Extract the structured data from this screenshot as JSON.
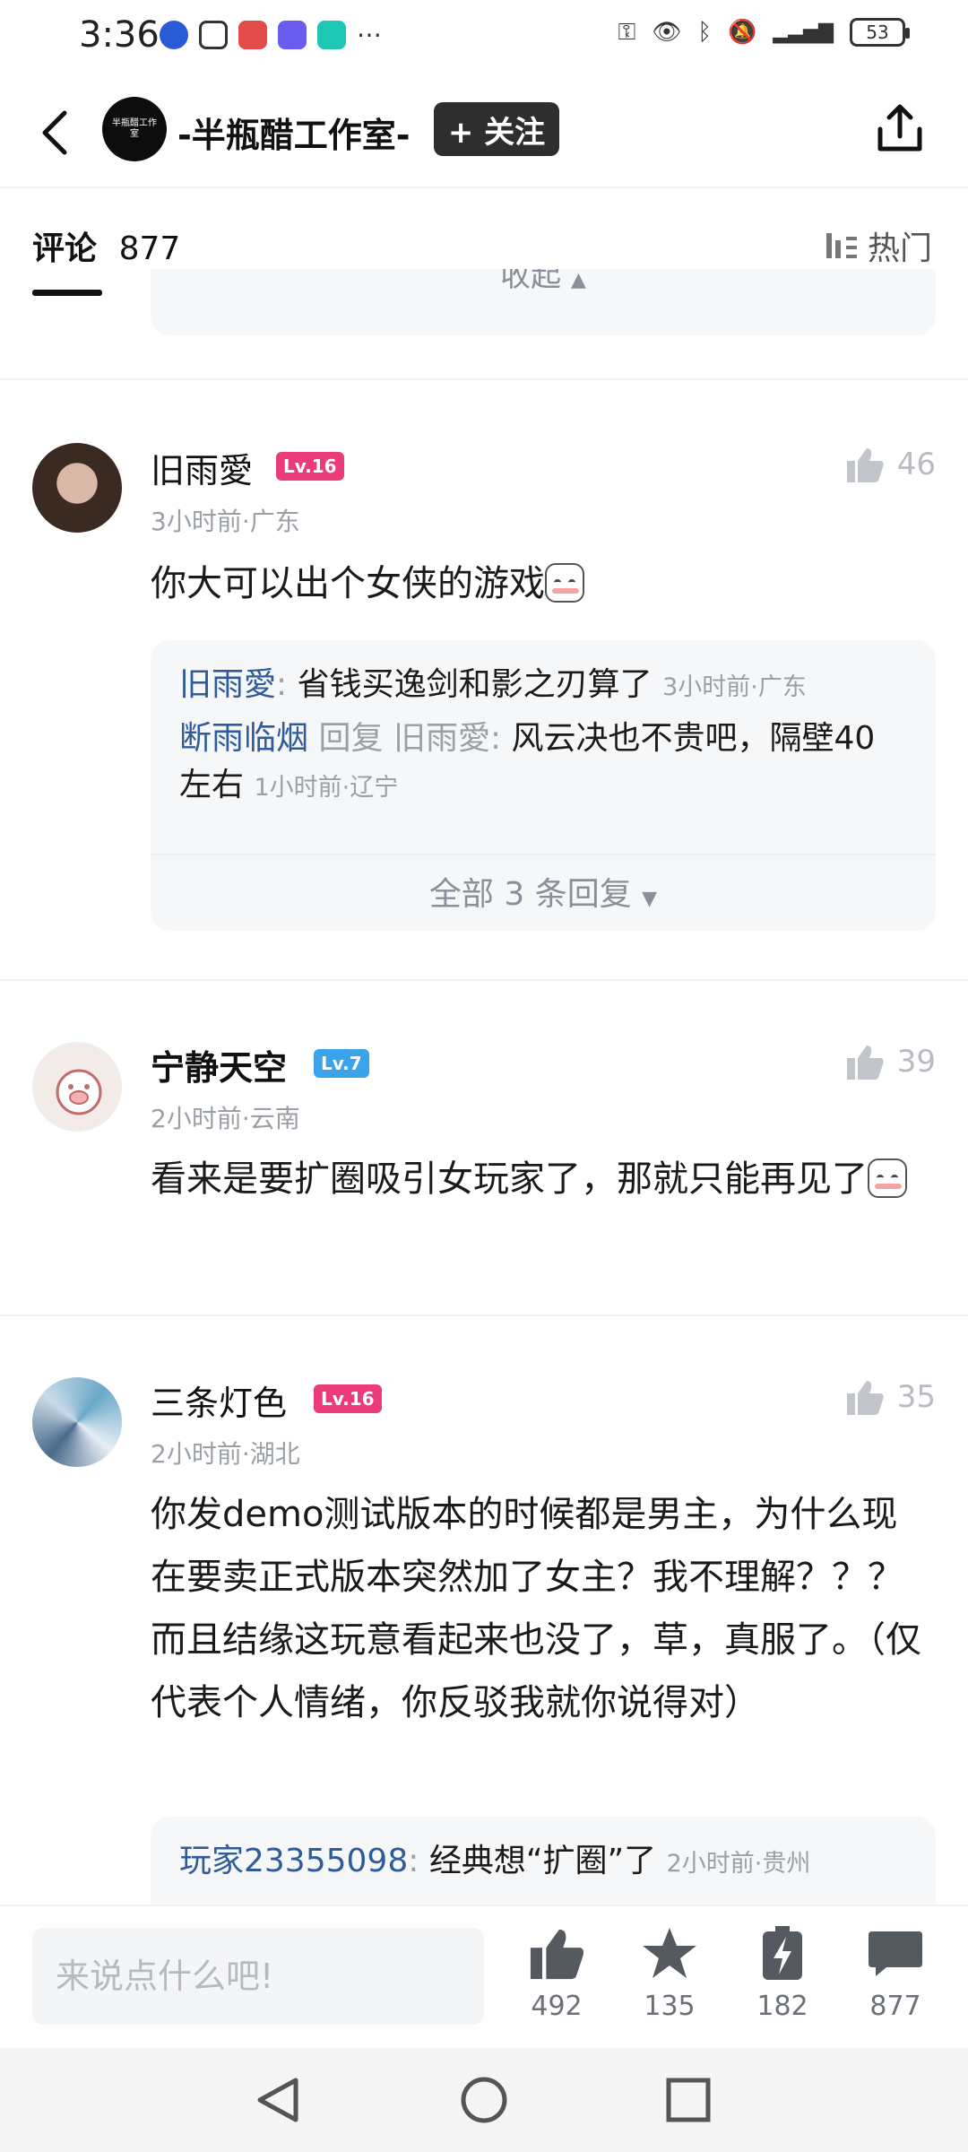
{
  "status_bar": {
    "time": "3:36",
    "battery": "53"
  },
  "header": {
    "channel_name": "-半瓶醋工作室-",
    "follow_label": "+ 关注",
    "avatar_text": "半瓶醋工作室"
  },
  "tabs": {
    "comments_label": "评论",
    "comments_count": "877",
    "sort_label": "热门"
  },
  "collapse_label": "收起",
  "comments": [
    {
      "name": "旧雨愛",
      "level": "Lv.16",
      "meta": "3小时前·广东",
      "likes": "46",
      "text": "你大可以出个女侠的游戏",
      "replies": [
        {
          "name": "旧雨愛",
          "text": "省钱买逸剑和影之刃算了",
          "meta": "3小时前·广东"
        },
        {
          "name": "断雨临烟",
          "reply_word": "回复",
          "target": "旧雨愛",
          "text": "风云决也不贵吧，隔壁40左右",
          "meta": "1小时前·辽宁"
        }
      ],
      "more_replies": "全部 3 条回复"
    },
    {
      "name": "宁静天空",
      "level": "Lv.7",
      "meta": "2小时前·云南",
      "likes": "39",
      "text": "看来是要扩圈吸引女玩家了，那就只能再见了"
    },
    {
      "name": "三条灯色",
      "level": "Lv.16",
      "meta": "2小时前·湖北",
      "likes": "35",
      "text": "你发demo测试版本的时候都是男主，为什么现在要卖正式版本突然加了女主？我不理解？？？而且结缘这玩意看起来也没了，草，真服了。（仅代表个人情绪，你反驳我就你说得对）",
      "replies": [
        {
          "name": "玩家23355098",
          "text": "经典想“扩圈”了",
          "meta": "2小时前·贵州"
        }
      ]
    }
  ],
  "bottom_bar": {
    "input_placeholder": "来说点什么吧!",
    "like_count": "492",
    "star_count": "135",
    "charge_count": "182",
    "comment_count": "877"
  }
}
